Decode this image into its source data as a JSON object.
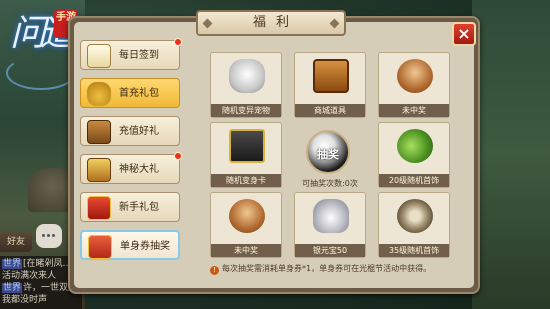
{
  "game": {
    "logo_text": "问道",
    "logo_badge": "手游"
  },
  "hud": {
    "friend_tab": "好友",
    "chat": [
      {
        "tag": "世界",
        "text": "[在睹剁凤…"
      },
      {
        "tag": "",
        "text": "活动满次来人"
      },
      {
        "tag": "世界",
        "text": "许，一世双删没安韵的初说话"
      },
      {
        "tag": "",
        "text": "我都没时声"
      }
    ]
  },
  "panel": {
    "title": "福利",
    "close": "×",
    "tabs": [
      {
        "label": "每日签到",
        "icon": "calendar-icon",
        "badge": true,
        "state": ""
      },
      {
        "label": "首充礼包",
        "icon": "money-bag-icon",
        "badge": false,
        "state": "active"
      },
      {
        "label": "充值好礼",
        "icon": "treasure-chest-icon",
        "badge": false,
        "state": ""
      },
      {
        "label": "神秘大礼",
        "icon": "mystery-chest-icon",
        "badge": true,
        "state": ""
      },
      {
        "label": "新手礼包",
        "icon": "gift-box-icon",
        "badge": false,
        "state": ""
      },
      {
        "label": "单身券抽奖",
        "icon": "lottery-gift-icon",
        "badge": false,
        "state": "selected"
      }
    ],
    "prizes": [
      {
        "label": "随机变异宠物",
        "icon": "pet-icon"
      },
      {
        "label": "商城道具",
        "icon": "chest-icon"
      },
      {
        "label": "未中奖",
        "icon": "monkey-icon"
      },
      {
        "label": "随机变身卡",
        "icon": "card-icon"
      },
      {
        "label": "20级随机首饰",
        "icon": "jade-pendant-icon"
      },
      {
        "label": "未中奖",
        "icon": "monkey-icon"
      },
      {
        "label": "银元宝50",
        "icon": "silver-ingot-icon"
      },
      {
        "label": "35级随机首饰",
        "icon": "jade-ring-icon"
      }
    ],
    "draw_button": "抽奖",
    "draw_count": "可抽奖次数:0次",
    "notice": "每次抽奖需消耗单身券*1，单身券可在光棍节活动中获得。"
  }
}
